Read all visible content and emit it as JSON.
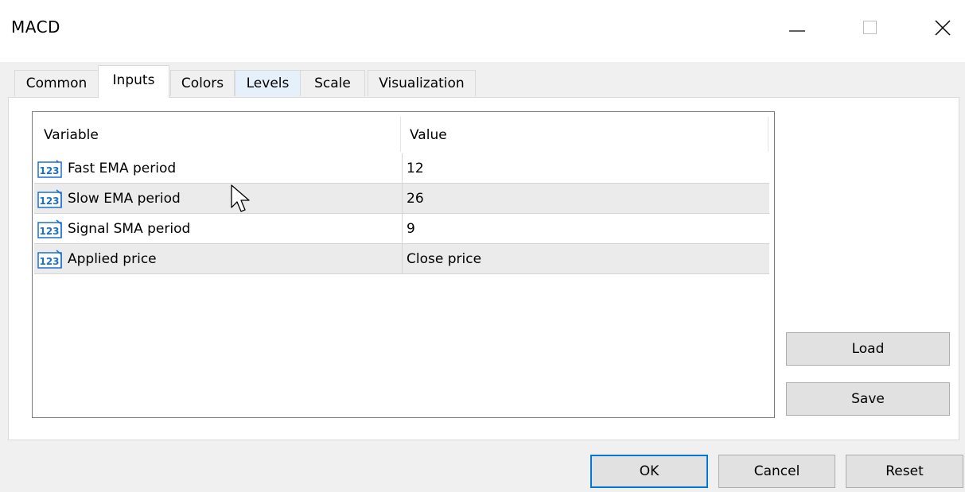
{
  "window": {
    "title": "MACD"
  },
  "tabs": [
    {
      "label": "Common"
    },
    {
      "label": "Inputs"
    },
    {
      "label": "Colors"
    },
    {
      "label": "Levels"
    },
    {
      "label": "Scale"
    },
    {
      "label": "Visualization"
    }
  ],
  "grid": {
    "columns": [
      "Variable",
      "Value"
    ],
    "rows": [
      {
        "icon": "123",
        "variable": "Fast EMA period",
        "value": "12"
      },
      {
        "icon": "123",
        "variable": "Slow EMA period",
        "value": "26"
      },
      {
        "icon": "123",
        "variable": "Signal SMA period",
        "value": "9"
      },
      {
        "icon": "123",
        "variable": "Applied price",
        "value": "Close price"
      }
    ]
  },
  "side_buttons": {
    "load": "Load",
    "save": "Save"
  },
  "footer": {
    "ok": "OK",
    "cancel": "Cancel",
    "reset": "Reset"
  },
  "colors": {
    "accent": "#0078d7",
    "icon_blue": "#1c6fd1"
  }
}
